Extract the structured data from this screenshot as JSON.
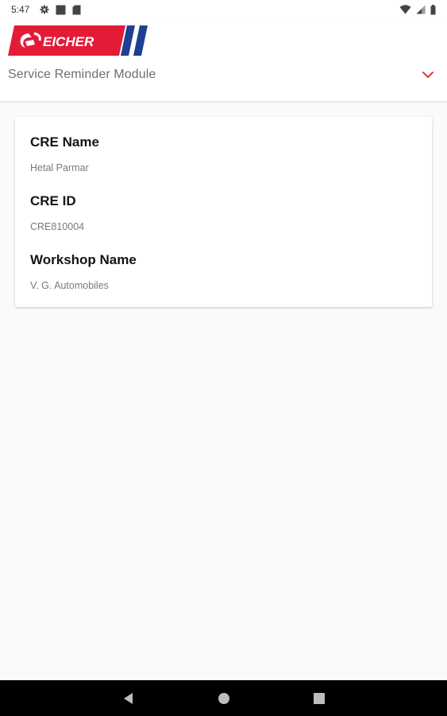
{
  "status_bar": {
    "time": "5:47",
    "left_icons": [
      "settings-icon",
      "notification-square-icon",
      "sd-card-icon"
    ],
    "right_icons": [
      "wifi-icon",
      "cell-signal-icon",
      "battery-icon"
    ]
  },
  "app_bar": {
    "brand": "EICHER",
    "module_title": "Service Reminder Module",
    "chevron_icon": "chevron-down-icon"
  },
  "card": {
    "fields": [
      {
        "label": "CRE Name",
        "value": "Hetal Parmar"
      },
      {
        "label": "CRE ID",
        "value": "CRE810004"
      },
      {
        "label": "Workshop Name",
        "value": "V. G. Automobiles"
      }
    ]
  },
  "nav_bar": {
    "buttons": [
      "back-icon",
      "home-icon",
      "recents-icon"
    ]
  },
  "colors": {
    "brand_red": "#e31b37",
    "brand_blue": "#1d3f94",
    "accent_red": "#e53935"
  }
}
